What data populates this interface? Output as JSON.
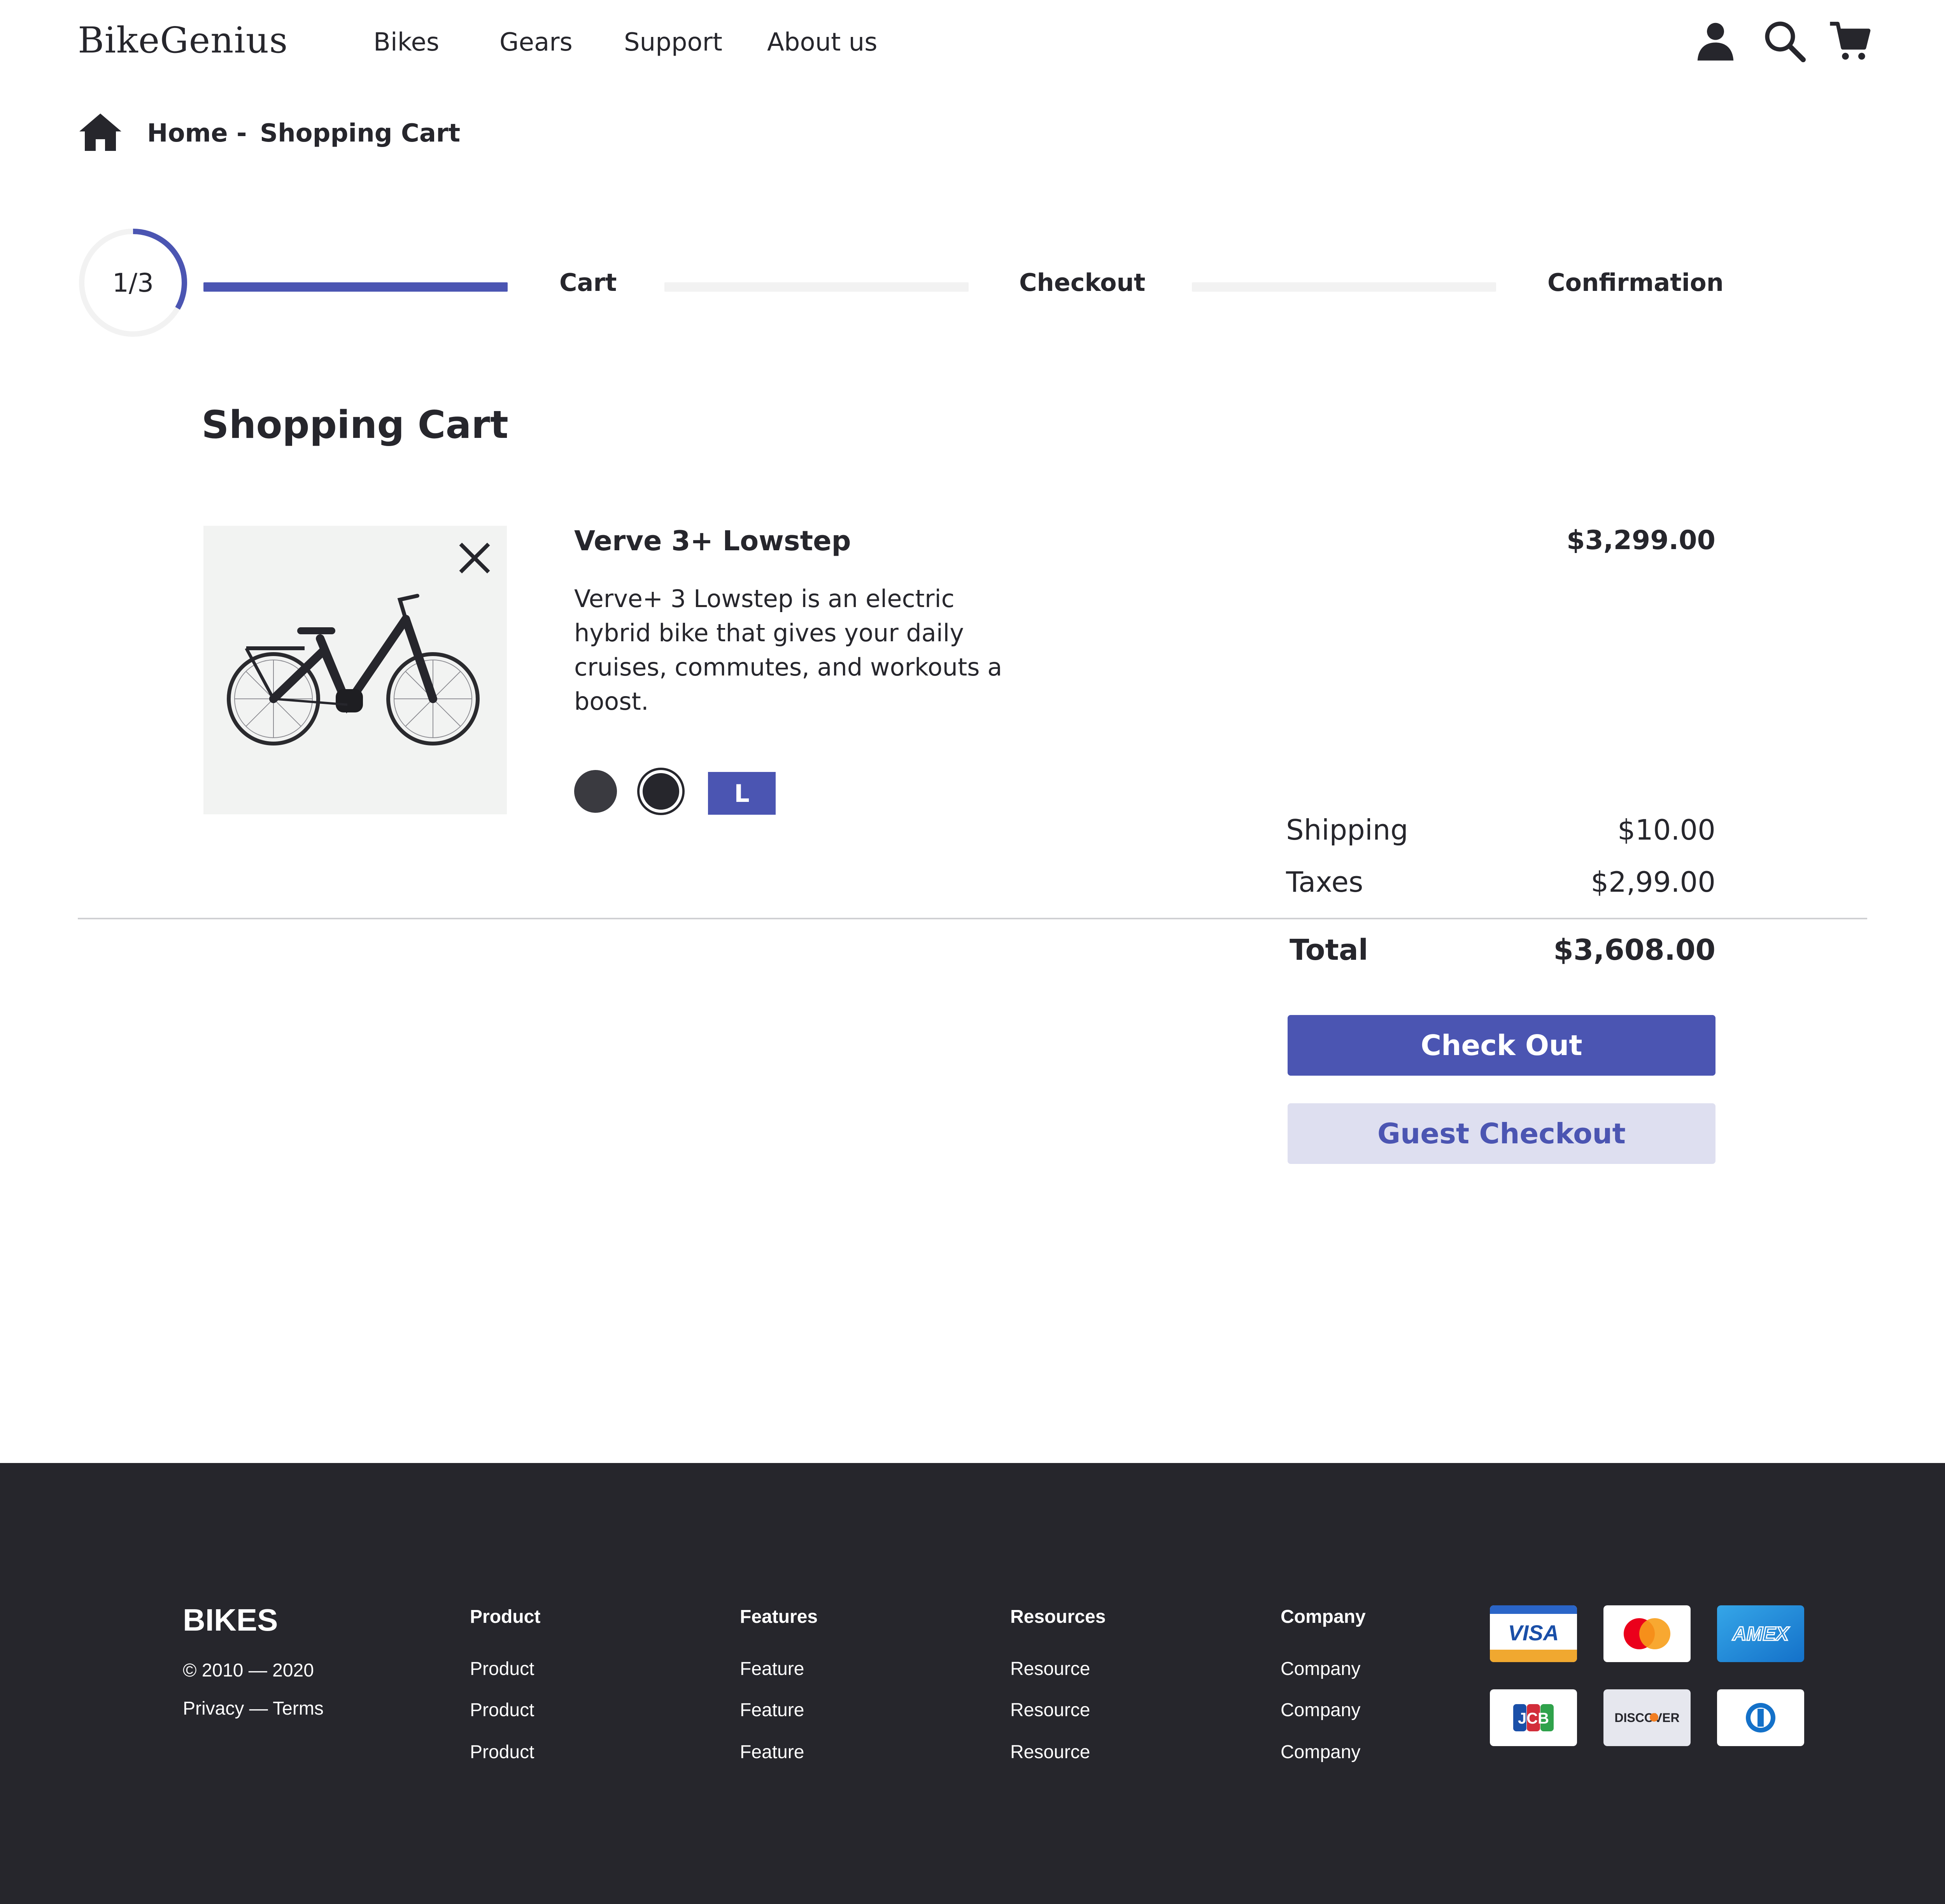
{
  "header": {
    "logo": "BikeGenius",
    "nav": [
      "Bikes",
      "Gears",
      "Support",
      "About us"
    ],
    "icons": [
      "user-icon",
      "search-icon",
      "cart-icon"
    ]
  },
  "breadcrumb": {
    "home": "Home",
    "separator": "-",
    "current": "Shopping Cart"
  },
  "steps": {
    "indicator": "1/3",
    "labels": [
      "Cart",
      "Checkout",
      "Confirmation"
    ],
    "progress": 0.333
  },
  "cart": {
    "title": "Shopping Cart",
    "item": {
      "name": "Verve 3+ Lowstep",
      "description": "Verve+ 3 Lowstep is an electric hybrid bike that gives your daily cruises, commutes, and workouts a boost.",
      "price": "$3,299.00",
      "colors": [
        "#3a3a40",
        "#26262c"
      ],
      "selected_color_index": 1,
      "size": "L"
    }
  },
  "summary": {
    "shipping_label": "Shipping",
    "shipping_value": "$10.00",
    "taxes_label": "Taxes",
    "taxes_value": "$2,99.00",
    "total_label": "Total",
    "total_value": "$3,608.00",
    "checkout_button": "Check Out",
    "guest_button": "Guest Checkout"
  },
  "footer": {
    "brand": "BIKES",
    "copyright": "© 2010 — 2020",
    "legal": "Privacy — Terms",
    "columns": [
      {
        "heading": "Product",
        "links": [
          "Product",
          "Product",
          "Product"
        ]
      },
      {
        "heading": "Features",
        "links": [
          "Feature",
          "Feature",
          "Feature"
        ]
      },
      {
        "heading": "Resources",
        "links": [
          "Resource",
          "Resource",
          "Resource"
        ]
      },
      {
        "heading": "Company",
        "links": [
          "Company",
          "Company",
          "Company"
        ]
      }
    ],
    "payment_methods": [
      "VISA",
      "mastercard-logo",
      "AMEX",
      "JCB",
      "DISCOVER",
      "diners-club-logo"
    ]
  },
  "colors": {
    "accent": "#4b55b2",
    "accent_light": "#dedff0",
    "text": "#26262c",
    "footer_bg": "#26262c",
    "track": "#f2f2f2"
  }
}
